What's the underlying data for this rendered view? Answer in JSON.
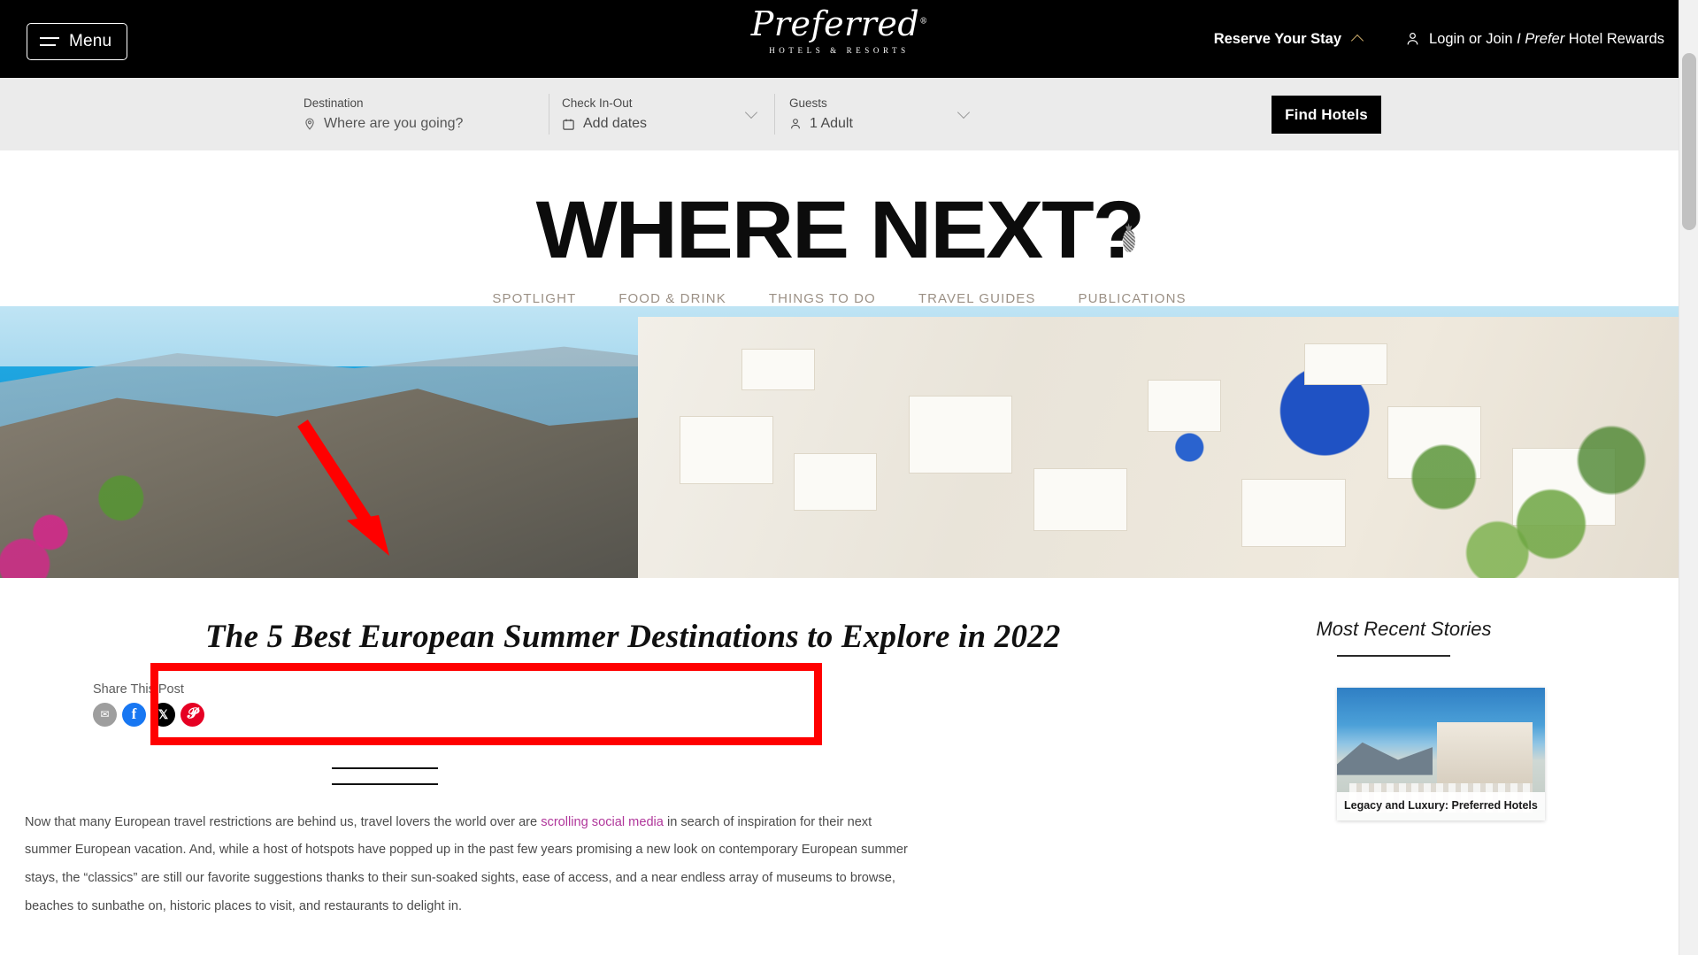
{
  "header": {
    "menu_label": "Menu",
    "brand_script": "Preferred",
    "brand_trademark": "®",
    "brand_sub": "HOTELS & RESORTS",
    "reserve_label": "Reserve Your Stay",
    "login_prefix": "Login or Join ",
    "login_italic": "I Prefer",
    "login_suffix": " Hotel Rewards"
  },
  "booking": {
    "destination_label": "Destination",
    "destination_placeholder": "Where are you going?",
    "dates_label": "Check In-Out",
    "dates_value": "Add dates",
    "guests_label": "Guests",
    "guests_value": "1 Adult",
    "find_label": "Find Hotels"
  },
  "masthead": {
    "title_main": "WHERE NEXT",
    "title_q": "?",
    "nav": [
      {
        "label": "SPOTLIGHT"
      },
      {
        "label": "FOOD & DRINK"
      },
      {
        "label": "THINGS TO DO"
      },
      {
        "label": "TRAVEL GUIDES"
      },
      {
        "label": "PUBLICATIONS"
      }
    ]
  },
  "article": {
    "title": "The 5 Best European Summer Destinations to Explore in 2022",
    "share_label": "Share This Post",
    "share_icons": [
      {
        "name": "email-share-icon",
        "glyph": "✉"
      },
      {
        "name": "facebook-share-icon",
        "glyph": "f"
      },
      {
        "name": "x-twitter-share-icon",
        "glyph": "𝕏"
      },
      {
        "name": "pinterest-share-icon",
        "glyph": "𝓟"
      }
    ],
    "body_part1": "Now that many European travel restrictions are behind us, travel lovers the world over are ",
    "body_link": "scrolling social media",
    "body_part2": " in search of inspiration for their next summer European vacation. And, while a host of hotspots have popped up in the past few years promising a new look on contemporary European summer stays, the “classics” are still our favorite suggestions thanks to their sun-soaked sights, ease of access, and a near endless array of museums to browse, beaches to sunbathe on, historic places to visit, and restaurants to delight in."
  },
  "sidebar": {
    "title": "Most Recent Stories",
    "stories": [
      {
        "caption": "Legacy and Luxury: Preferred Hotels"
      }
    ]
  },
  "colors": {
    "accent_gold": "#c9a96a",
    "link_magenta": "#b0379b",
    "annotation_red": "#ff0000",
    "nav_tan": "#9b9085",
    "facebook_blue": "#1877f2",
    "pinterest_red": "#e60023"
  }
}
